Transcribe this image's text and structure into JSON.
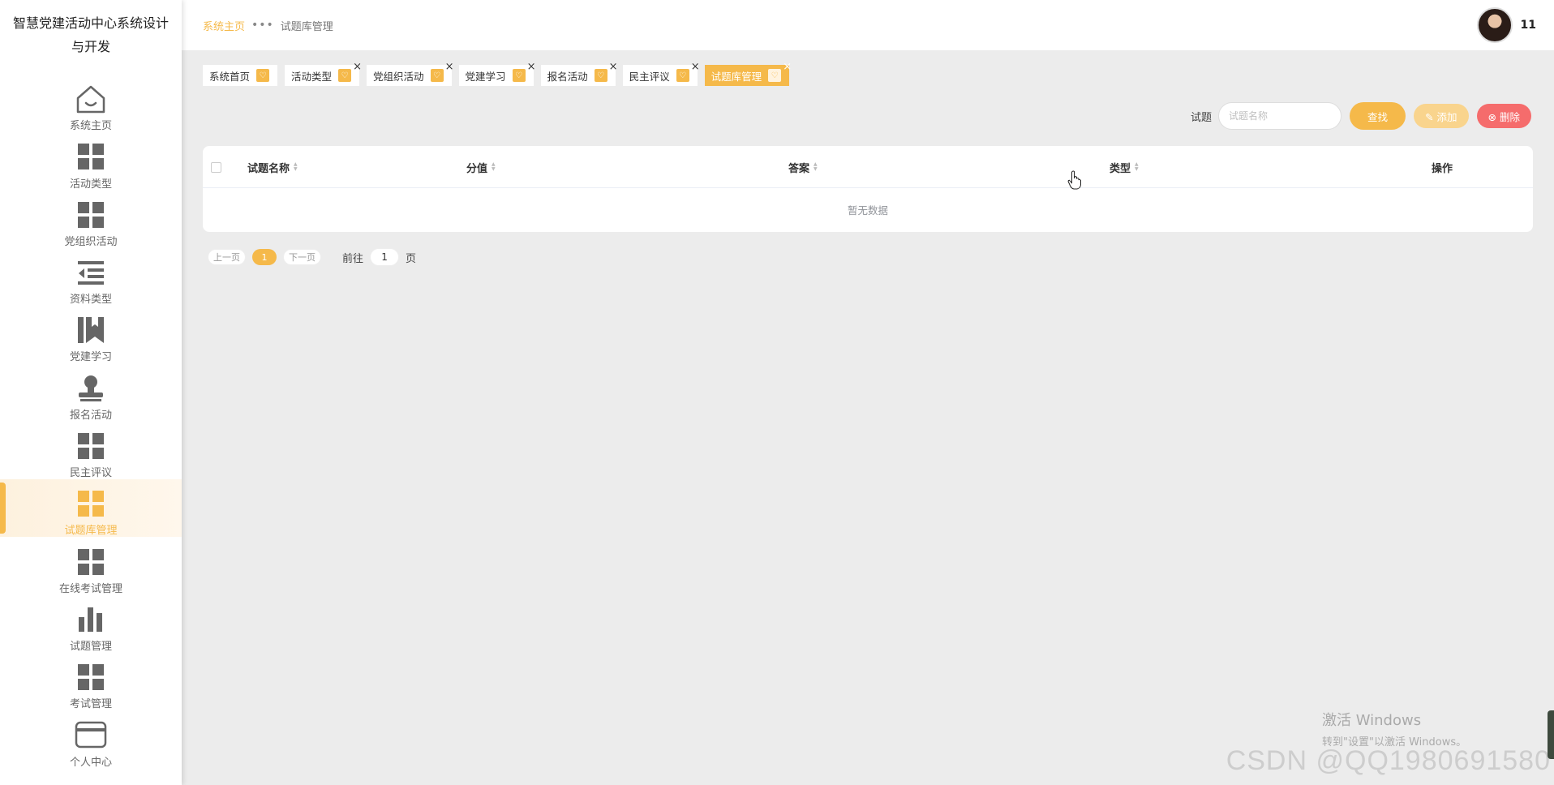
{
  "app": {
    "title": "智慧党建活动中心系统设计与开发"
  },
  "sidebar": {
    "items": [
      {
        "label": "系统主页",
        "icon": "home-icon",
        "active": false
      },
      {
        "label": "活动类型",
        "icon": "grid-icon",
        "active": false
      },
      {
        "label": "党组织活动",
        "icon": "grid-icon",
        "active": false
      },
      {
        "label": "资料类型",
        "icon": "list-indent-icon",
        "active": false
      },
      {
        "label": "党建学习",
        "icon": "book-icon",
        "active": false
      },
      {
        "label": "报名活动",
        "icon": "stamp-icon",
        "active": false
      },
      {
        "label": "民主评议",
        "icon": "grid-icon",
        "active": false
      },
      {
        "label": "试题库管理",
        "icon": "grid-icon",
        "active": true
      },
      {
        "label": "在线考试管理",
        "icon": "grid-icon",
        "active": false
      },
      {
        "label": "试题管理",
        "icon": "bar-chart-icon",
        "active": false
      },
      {
        "label": "考试管理",
        "icon": "grid-icon",
        "active": false
      },
      {
        "label": "个人中心",
        "icon": "card-icon",
        "active": false
      }
    ]
  },
  "header": {
    "breadcrumb": {
      "home": "系统主页",
      "separator": "•••",
      "current": "试题库管理"
    },
    "user": {
      "name": "11"
    }
  },
  "tags": [
    {
      "label": "系统首页",
      "closable": false,
      "active": false
    },
    {
      "label": "活动类型",
      "closable": true,
      "active": false
    },
    {
      "label": "党组织活动",
      "closable": true,
      "active": false
    },
    {
      "label": "党建学习",
      "closable": true,
      "active": false
    },
    {
      "label": "报名活动",
      "closable": true,
      "active": false
    },
    {
      "label": "民主评议",
      "closable": true,
      "active": false
    },
    {
      "label": "试题库管理",
      "closable": true,
      "active": true
    }
  ],
  "search": {
    "label": "试题",
    "placeholder": "试题名称",
    "search_button": "查找",
    "add_button": "添加",
    "delete_button": "删除"
  },
  "table": {
    "columns": [
      "试题名称",
      "分值",
      "答案",
      "类型",
      "操作"
    ],
    "rows": [],
    "empty_text": "暂无数据"
  },
  "pagination": {
    "prev": "上一页",
    "current_page": "1",
    "next": "下一页",
    "goto_label": "前往",
    "goto_value": "1",
    "page_suffix": "页"
  },
  "watermarks": {
    "windows_line1": "激活 Windows",
    "windows_line2": "转到\"设置\"以激活 Windows。",
    "csdn": "CSDN @QQ1980691580"
  },
  "colors": {
    "accent": "#f5b94a",
    "accent_light": "#f9d48d",
    "danger": "#f56c6c",
    "background": "#ececec"
  }
}
